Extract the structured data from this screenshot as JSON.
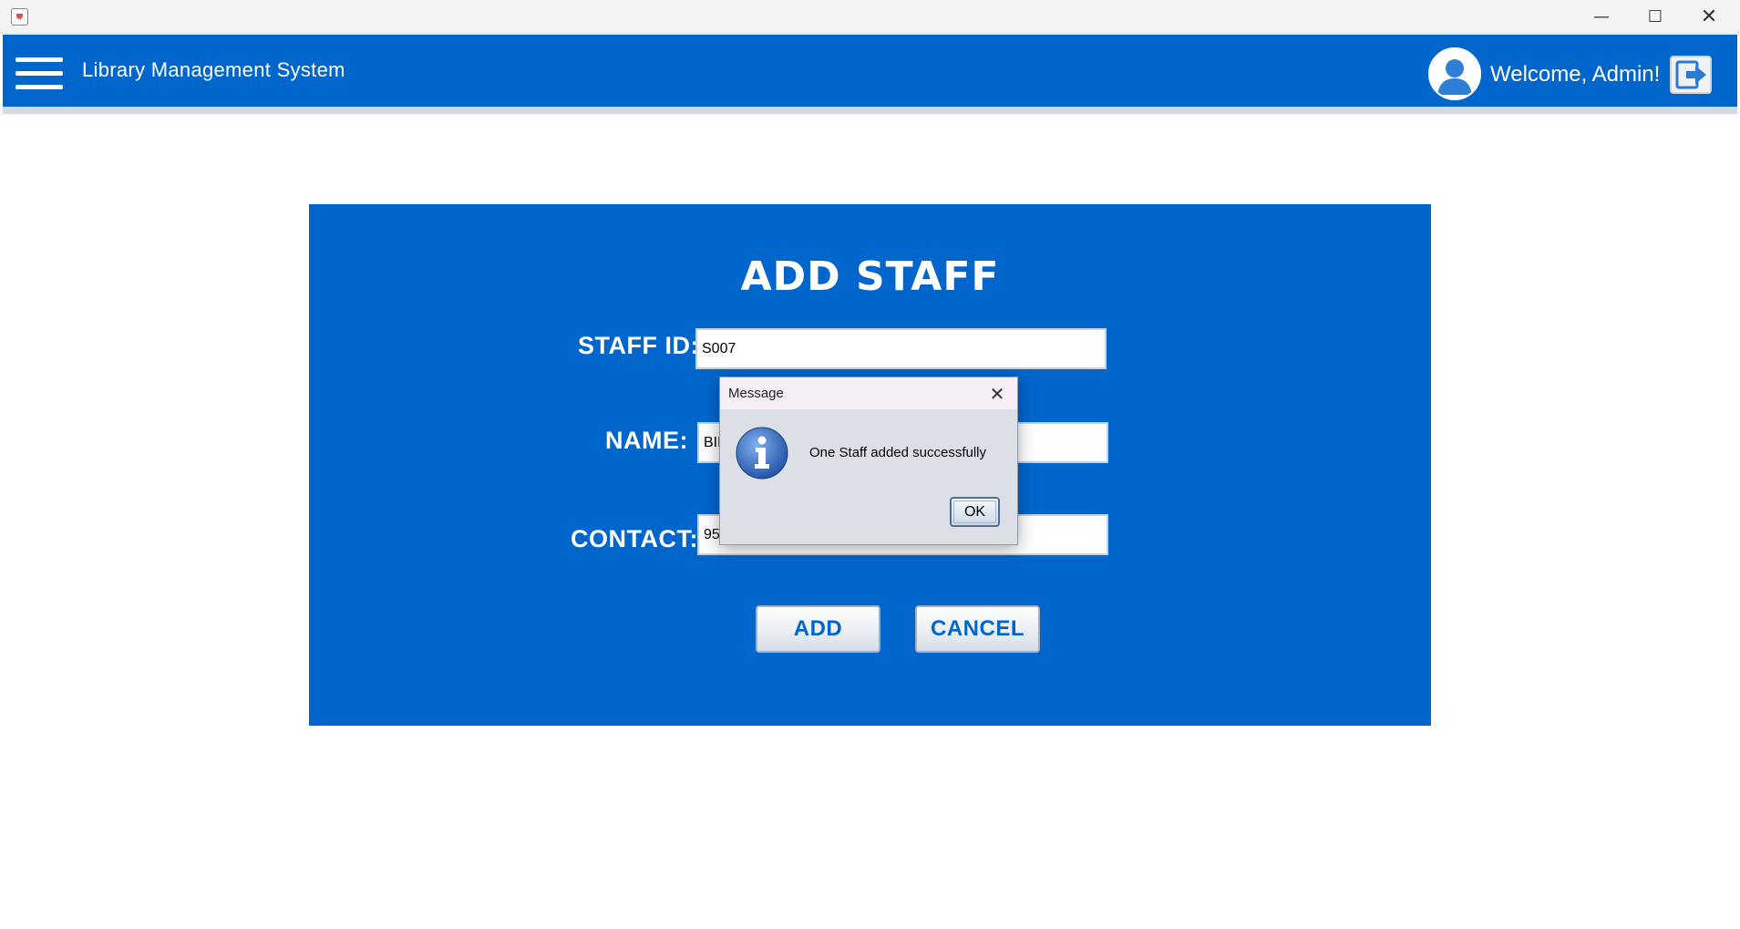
{
  "window": {
    "minimize_glyph": "—",
    "maximize_glyph": "☐",
    "close_glyph": "✕"
  },
  "header": {
    "title": "Library Management System",
    "welcome_text": "Welcome, Admin!",
    "menu_icon": "hamburger-icon",
    "avatar_icon": "user-avatar-icon",
    "logout_icon": "logout-icon"
  },
  "form": {
    "title": "ADD STAFF",
    "staff_id_label": "STAFF ID:",
    "staff_id_value": "S007",
    "name_label": "NAME:",
    "name_value": "BIN",
    "contact_label": "CONTACT:",
    "contact_value": "959",
    "add_label": "ADD",
    "cancel_label": "CANCEL"
  },
  "dialog": {
    "title": "Message",
    "close_glyph": "✕",
    "message": "One Staff added successfully",
    "ok_label": "OK",
    "icon": "info-icon"
  },
  "colors": {
    "brand_blue": "#0066cc",
    "panel_blue": "#0066cc",
    "dialog_bg": "#dce0e6"
  }
}
